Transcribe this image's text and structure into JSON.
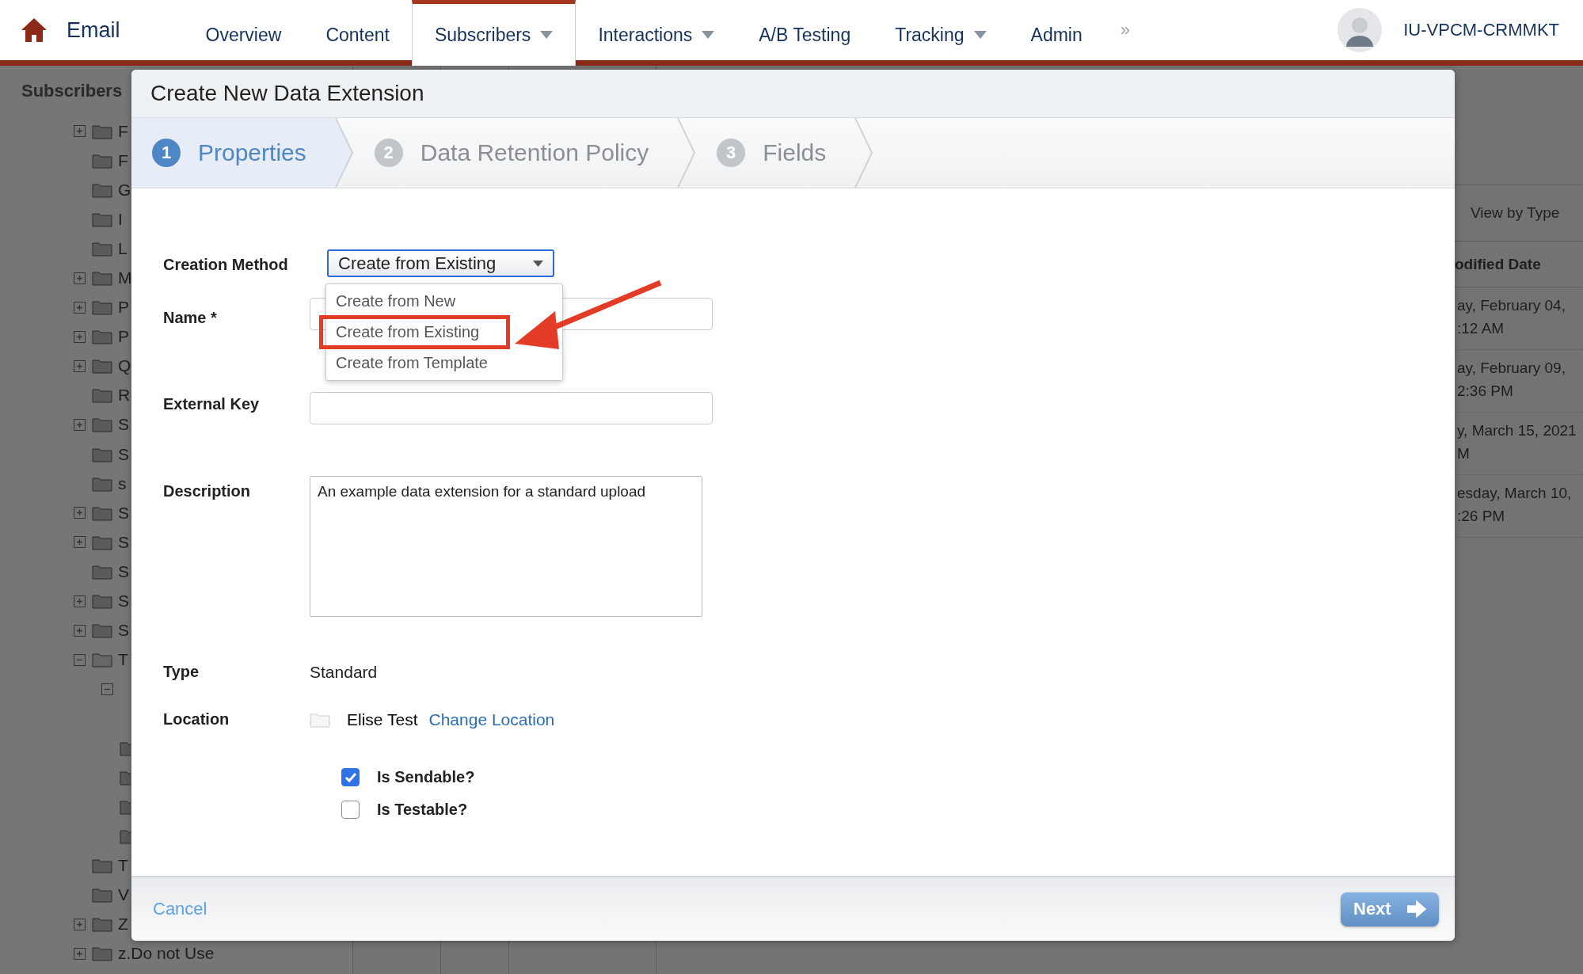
{
  "nav": {
    "app_name": "Email",
    "tabs": [
      {
        "label": "Overview",
        "selected": false,
        "has_menu": false
      },
      {
        "label": "Content",
        "selected": false,
        "has_menu": false
      },
      {
        "label": "Subscribers",
        "selected": true,
        "has_menu": true
      },
      {
        "label": "Interactions",
        "selected": false,
        "has_menu": true
      },
      {
        "label": "A/B Testing",
        "selected": false,
        "has_menu": false
      },
      {
        "label": "Tracking",
        "selected": false,
        "has_menu": true
      },
      {
        "label": "Admin",
        "selected": false,
        "has_menu": false
      }
    ],
    "more": "»",
    "account": "IU-VPCM-CRMMKT"
  },
  "sidebar": {
    "title": "Subscribers",
    "items": [
      {
        "label": "F",
        "expandable": true,
        "expanded": false
      },
      {
        "label": "F",
        "expandable": false
      },
      {
        "label": "G",
        "expandable": false
      },
      {
        "label": "I",
        "expandable": false
      },
      {
        "label": "L",
        "expandable": false
      },
      {
        "label": "M",
        "expandable": true,
        "expanded": false
      },
      {
        "label": "P",
        "expandable": true,
        "expanded": false
      },
      {
        "label": "P",
        "expandable": true,
        "expanded": false
      },
      {
        "label": "Q",
        "expandable": true,
        "expanded": false
      },
      {
        "label": "R",
        "expandable": false
      },
      {
        "label": "S",
        "expandable": true,
        "expanded": false
      },
      {
        "label": "S",
        "expandable": false
      },
      {
        "label": "s",
        "expandable": false
      },
      {
        "label": "S",
        "expandable": true,
        "expanded": false
      },
      {
        "label": "S",
        "expandable": true,
        "expanded": false
      },
      {
        "label": "S",
        "expandable": false
      },
      {
        "label": "S",
        "expandable": true,
        "expanded": false
      },
      {
        "label": "S",
        "expandable": true,
        "expanded": false
      },
      {
        "label": "T",
        "expandable": true,
        "expanded": true,
        "children": [
          {
            "expandable": true,
            "expanded": true,
            "children": [
              {
                "expandable": false
              },
              {
                "expandable": false
              },
              {
                "expandable": false
              },
              {
                "expandable": false
              }
            ]
          }
        ]
      },
      {
        "label": "T",
        "expandable": false
      },
      {
        "label": "V",
        "expandable": false
      },
      {
        "label": "Z",
        "expandable": true,
        "expanded": false
      },
      {
        "label": "z.Do not Use",
        "expandable": true,
        "expanded": false
      }
    ]
  },
  "list_panel": {
    "view_label": "View by Type",
    "column_header": "odified Date",
    "rows": [
      {
        "lines": [
          "ay, February 04,",
          ":12 AM"
        ]
      },
      {
        "lines": [
          "ay, February 09,",
          "2:36 PM"
        ]
      },
      {
        "lines": [
          "y, March 15, 2021",
          "M"
        ]
      },
      {
        "lines": [
          "esday, March 10,",
          ":26 PM"
        ]
      }
    ]
  },
  "dialog": {
    "title": "Create New Data Extension",
    "steps": [
      {
        "number": "1",
        "label": "Properties",
        "selected": true
      },
      {
        "number": "2",
        "label": "Data Retention Policy",
        "selected": false
      },
      {
        "number": "3",
        "label": "Fields",
        "selected": false
      }
    ],
    "creation_method": {
      "label": "Creation Method",
      "value": "Create from Existing",
      "expanded": true,
      "options": [
        {
          "label": "Create from New",
          "selected": false
        },
        {
          "label": "Create from Existing",
          "selected": true
        },
        {
          "label": "Create from Template",
          "selected": false
        }
      ]
    },
    "name": {
      "label": "Name *"
    },
    "external_key": {
      "label": "External Key"
    },
    "description": {
      "label": "Description",
      "value": "An example data extension for a standard upload"
    },
    "type": {
      "label": "Type",
      "value": "Standard"
    },
    "location": {
      "label": "Location",
      "folder": "Elise Test",
      "link": "Change Location"
    },
    "checkboxes": [
      {
        "label": "Is Sendable?",
        "checked": true
      },
      {
        "label": "Is Testable?",
        "checked": false
      }
    ],
    "cancel": "Cancel",
    "next": "Next"
  }
}
